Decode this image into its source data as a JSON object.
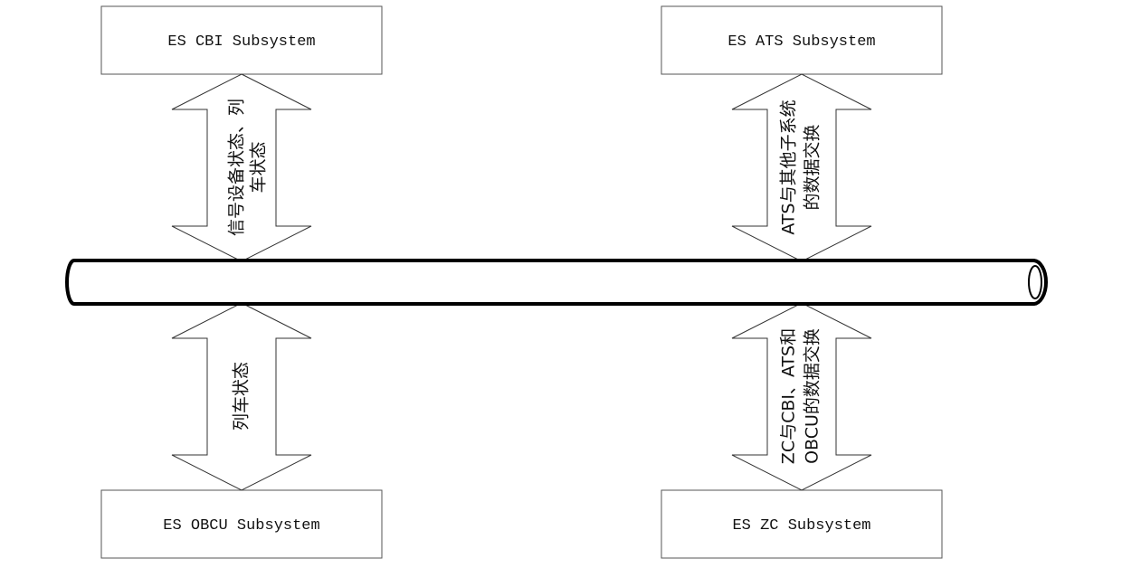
{
  "diagram": {
    "type": "bus-architecture",
    "bus": {
      "label": ""
    },
    "subsystems": [
      {
        "id": "cbi",
        "label": "ES CBI Subsystem",
        "position": "top-left"
      },
      {
        "id": "ats",
        "label": "ES ATS Subsystem",
        "position": "top-right"
      },
      {
        "id": "obcu",
        "label": "ES OBCU Subsystem",
        "position": "bottom-left"
      },
      {
        "id": "zc",
        "label": "ES ZC Subsystem",
        "position": "bottom-right"
      }
    ],
    "links": [
      {
        "from": "cbi",
        "lines": [
          "信号设备状态、列",
          "车状态"
        ]
      },
      {
        "from": "ats",
        "lines": [
          "ATS与其他子系统",
          "的数据交换"
        ]
      },
      {
        "from": "obcu",
        "lines": [
          "列车状态"
        ]
      },
      {
        "from": "zc",
        "lines": [
          "ZC与CBI、ATS和",
          "OBCU的数据交换"
        ]
      }
    ]
  }
}
